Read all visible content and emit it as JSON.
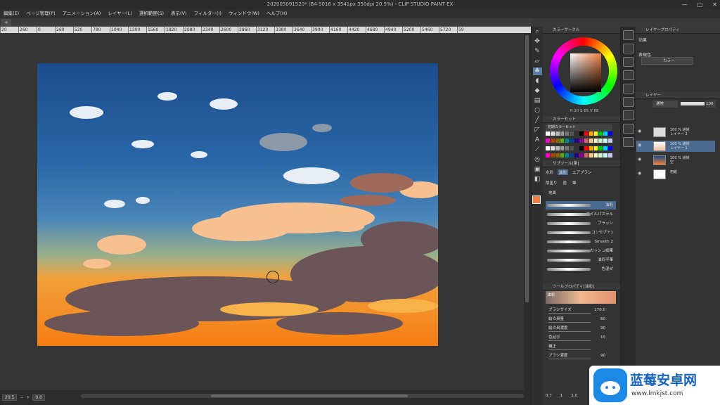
{
  "window": {
    "title": "202005091520* (B4 5016 x 3541px 350dpi 20.5%) - CLIP STUDIO PAINT EX",
    "controls": [
      "—",
      "□",
      "✕"
    ]
  },
  "menu": [
    "編集(E)",
    "ページ管理(P)",
    "アニメーション(A)",
    "レイヤー(L)",
    "選択範囲(S)",
    "表示(V)",
    "フィルター(I)",
    "ウィンドウ(W)",
    "ヘルプ(H)"
  ],
  "tab": {
    "label": "+"
  },
  "ruler": [
    "20",
    "260",
    "0",
    "260",
    "520",
    "780",
    "1040",
    "1300",
    "1560",
    "1820",
    "2080",
    "2340",
    "2600",
    "2860",
    "3120",
    "3380",
    "3640",
    "3900",
    "4160",
    "4420",
    "4680",
    "4940",
    "5200",
    "5460",
    "5720",
    "59"
  ],
  "status": {
    "zoom": "20.5",
    "angle": "0.0",
    "minus": "−",
    "plus": "+"
  },
  "colors": {
    "main": "#f08040",
    "accent": "#5a7ea8"
  },
  "color_wheel": {
    "title": "カラーサークル",
    "readout": "H 20  S 65  V 88"
  },
  "color_set": {
    "title": "カラーセット",
    "preset": "初期カラーセット"
  },
  "subtool": {
    "title": "サブツール[筆]",
    "tabs": [
      "水彩",
      "油彩",
      "エアブラシ"
    ],
    "tabs2": [
      "厚塗り",
      "墨",
      "筆"
    ],
    "group": "地面"
  },
  "brushes": [
    "油彩",
    "オイルパステル",
    "ブラッシ",
    "コンセプト1",
    "Smooth 2",
    "ガッシュ細筆",
    "油彩平筆",
    "色混ぜ"
  ],
  "tool_property": {
    "title": "ツールプロパティ[油彩]",
    "name": "油彩",
    "rows": [
      {
        "label": "ブラシサイズ",
        "value": "170.0"
      },
      {
        "label": "絵の具量",
        "value": "60"
      },
      {
        "label": "絵の具濃度",
        "value": "90"
      },
      {
        "label": "色延び",
        "value": "10"
      },
      {
        "label": "補正",
        "value": ""
      },
      {
        "label": "ブラシ濃度",
        "value": "90"
      }
    ]
  },
  "layer_prop": {
    "title": "レイヤープロパティ",
    "effect": "効果",
    "display_color": "表現色",
    "color_mode": "カラー"
  },
  "layers": {
    "title": "レイヤー",
    "blend": "通常",
    "opacity": "100",
    "items": [
      {
        "line1": "100 % 通常",
        "line2": "レイヤー 2"
      },
      {
        "line1": "100 % 通常",
        "line2": "レイヤー 1"
      },
      {
        "line1": "100 % 通常",
        "line2": "空"
      },
      {
        "line1": "",
        "line2": "用紙"
      }
    ]
  },
  "bottom_status": [
    "0.7",
    "1",
    "1.0"
  ],
  "watermark": {
    "title": "蓝莓安卓网",
    "url": "www.lmkjst.com"
  }
}
